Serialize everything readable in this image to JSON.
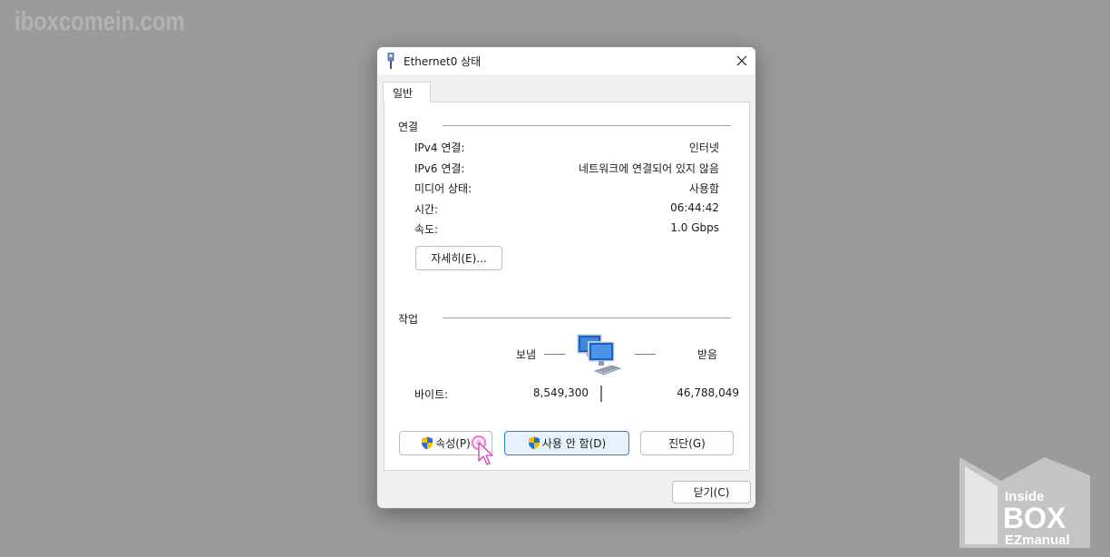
{
  "watermark": "iboxcomein.com",
  "logo": {
    "line1": "Inside",
    "line2": "BOX",
    "line3": "EZmanual"
  },
  "dialog": {
    "title": "Ethernet0 상태",
    "tab": "일반",
    "connection": {
      "section_title": "연결",
      "rows": [
        {
          "label": "IPv4 연결:",
          "value": "인터넷"
        },
        {
          "label": "IPv6 연결:",
          "value": "네트워크에 연결되어 있지 않음"
        },
        {
          "label": "미디어 상태:",
          "value": "사용함"
        },
        {
          "label": "시간:",
          "value": "06:44:42"
        },
        {
          "label": "속도:",
          "value": "1.0 Gbps"
        }
      ],
      "details_button": "자세히(E)..."
    },
    "activity": {
      "section_title": "작업",
      "sent_label": "보냄",
      "received_label": "받음",
      "bytes_label": "바이트:",
      "bytes_sent": "8,549,300",
      "bytes_received": "46,788,049"
    },
    "buttons": {
      "properties": "속성(P)",
      "disable": "사용 안 함(D)",
      "diagnose": "진단(G)",
      "close": "닫기(C)"
    }
  },
  "colors": {
    "accent": "#2f7fd3",
    "background": "#9a9b9a",
    "cursor_highlight": "#e060c0"
  }
}
